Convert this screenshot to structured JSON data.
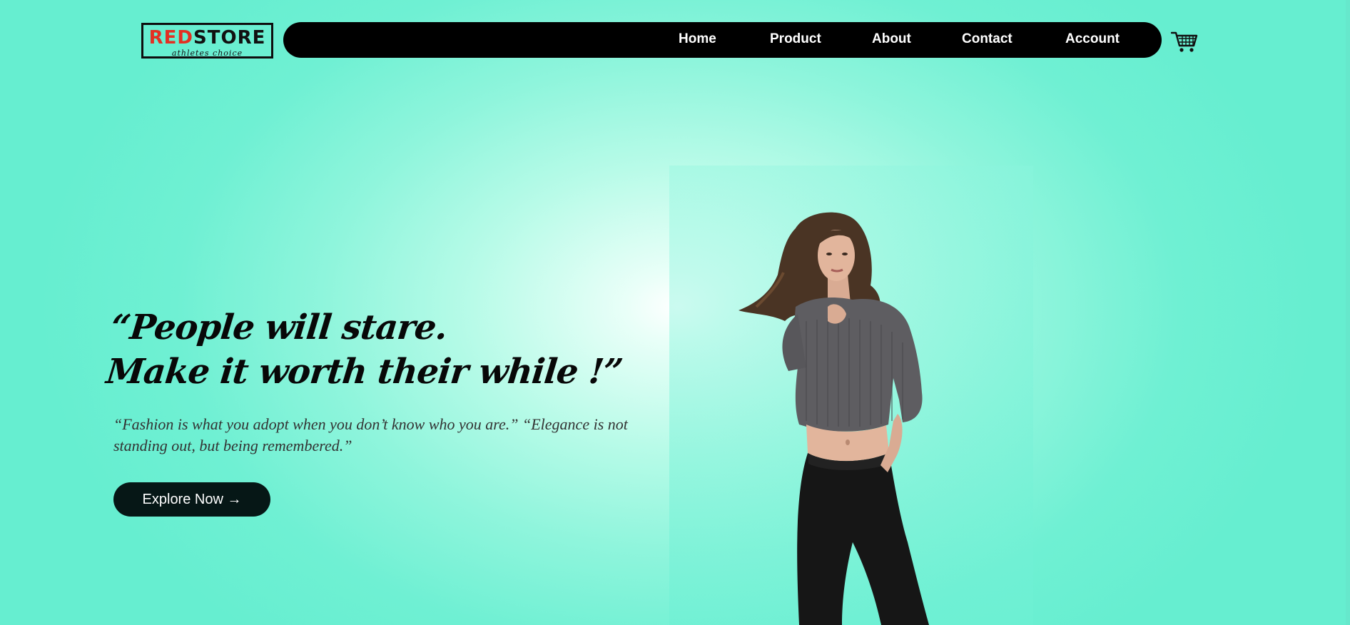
{
  "logo": {
    "word_red": "RED",
    "word_black": "STORE",
    "tagline": "athletes choice"
  },
  "nav": {
    "items": [
      "Home",
      "Product",
      "About",
      "Contact",
      "Account"
    ],
    "cart_icon": "shopping-cart-icon"
  },
  "hero": {
    "headline_line1": "“People will stare.",
    "headline_line2": "Make it worth their while !”",
    "quote": "“Fashion is what you adopt when you don’t know who you are.” “Elegance is not standing out, but being remembered.”",
    "cta_label": "Explore Now →"
  },
  "colors": {
    "accent": "#e33023",
    "background": "#6ff0d3",
    "nav_bg": "#000000",
    "button_bg": "#061716"
  }
}
